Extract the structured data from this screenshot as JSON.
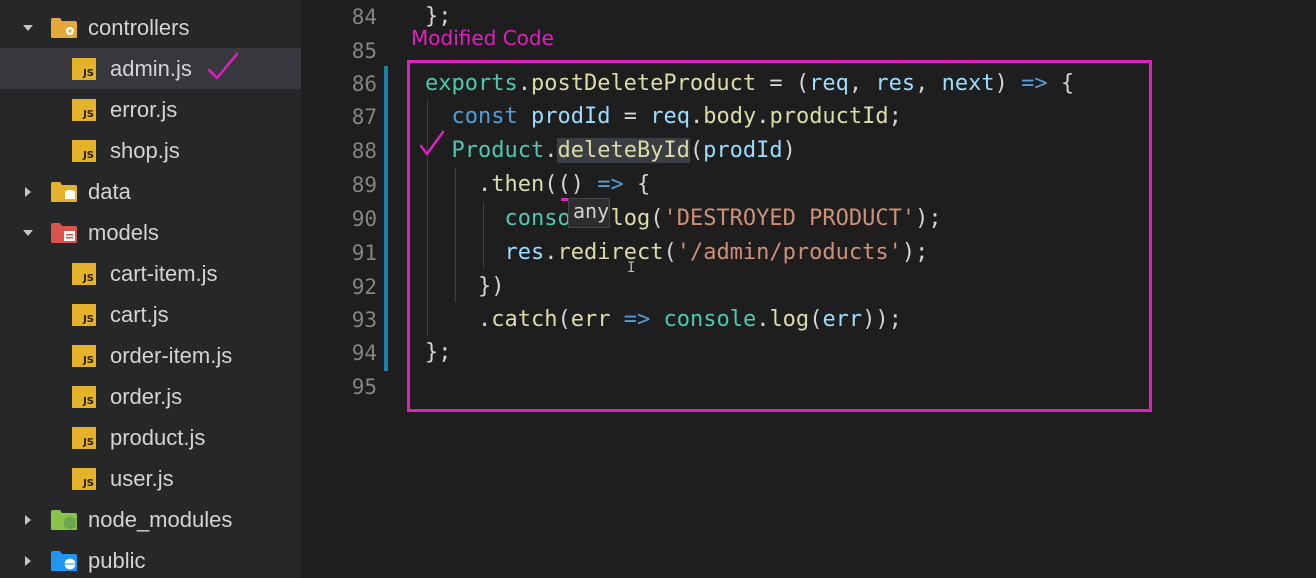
{
  "sidebar": {
    "items": [
      {
        "type": "folder",
        "expanded": true,
        "label": "controllers",
        "icon": "folder-gear-icon",
        "color": "#e5a83b"
      },
      {
        "type": "file",
        "label": "admin.js",
        "icon": "js-file-icon",
        "selected": true,
        "annotated": true
      },
      {
        "type": "file",
        "label": "error.js",
        "icon": "js-file-icon"
      },
      {
        "type": "file",
        "label": "shop.js",
        "icon": "js-file-icon"
      },
      {
        "type": "folder",
        "expanded": false,
        "label": "data",
        "icon": "folder-database-icon",
        "color": "#e5b22b"
      },
      {
        "type": "folder",
        "expanded": true,
        "label": "models",
        "icon": "folder-models-icon",
        "color": "#d9534f"
      },
      {
        "type": "file",
        "label": "cart-item.js",
        "icon": "js-file-icon"
      },
      {
        "type": "file",
        "label": "cart.js",
        "icon": "js-file-icon"
      },
      {
        "type": "file",
        "label": "order-item.js",
        "icon": "js-file-icon"
      },
      {
        "type": "file",
        "label": "order.js",
        "icon": "js-file-icon"
      },
      {
        "type": "file",
        "label": "product.js",
        "icon": "js-file-icon"
      },
      {
        "type": "file",
        "label": "user.js",
        "icon": "js-file-icon"
      },
      {
        "type": "folder",
        "expanded": false,
        "label": "node_modules",
        "icon": "folder-node-icon",
        "color": "#8bc34a"
      },
      {
        "type": "folder",
        "expanded": false,
        "label": "public",
        "icon": "folder-public-icon",
        "color": "#2196f3"
      }
    ],
    "file_icon_text": "JS"
  },
  "editor": {
    "annotation_title": "Modified Code",
    "hint_text": "any",
    "accent_color": "#e01fc0",
    "lines": [
      {
        "n": "84",
        "code": "};"
      },
      {
        "n": "85",
        "code": ""
      },
      {
        "n": "86",
        "code": "exports.postDeleteProduct = (req, res, next) => {"
      },
      {
        "n": "87",
        "code": "  const prodId = req.body.productId;"
      },
      {
        "n": "88",
        "code": "  Product.deleteById(prodId)"
      },
      {
        "n": "89",
        "code": "    .then(() => {"
      },
      {
        "n": "90",
        "code": "      console.log('DESTROYED PRODUCT');"
      },
      {
        "n": "91",
        "code": "      res.redirect('/admin/products');"
      },
      {
        "n": "92",
        "code": "    })"
      },
      {
        "n": "93",
        "code": "    .catch(err => console.log(err));"
      },
      {
        "n": "94",
        "code": "};"
      },
      {
        "n": "95",
        "code": ""
      }
    ]
  }
}
